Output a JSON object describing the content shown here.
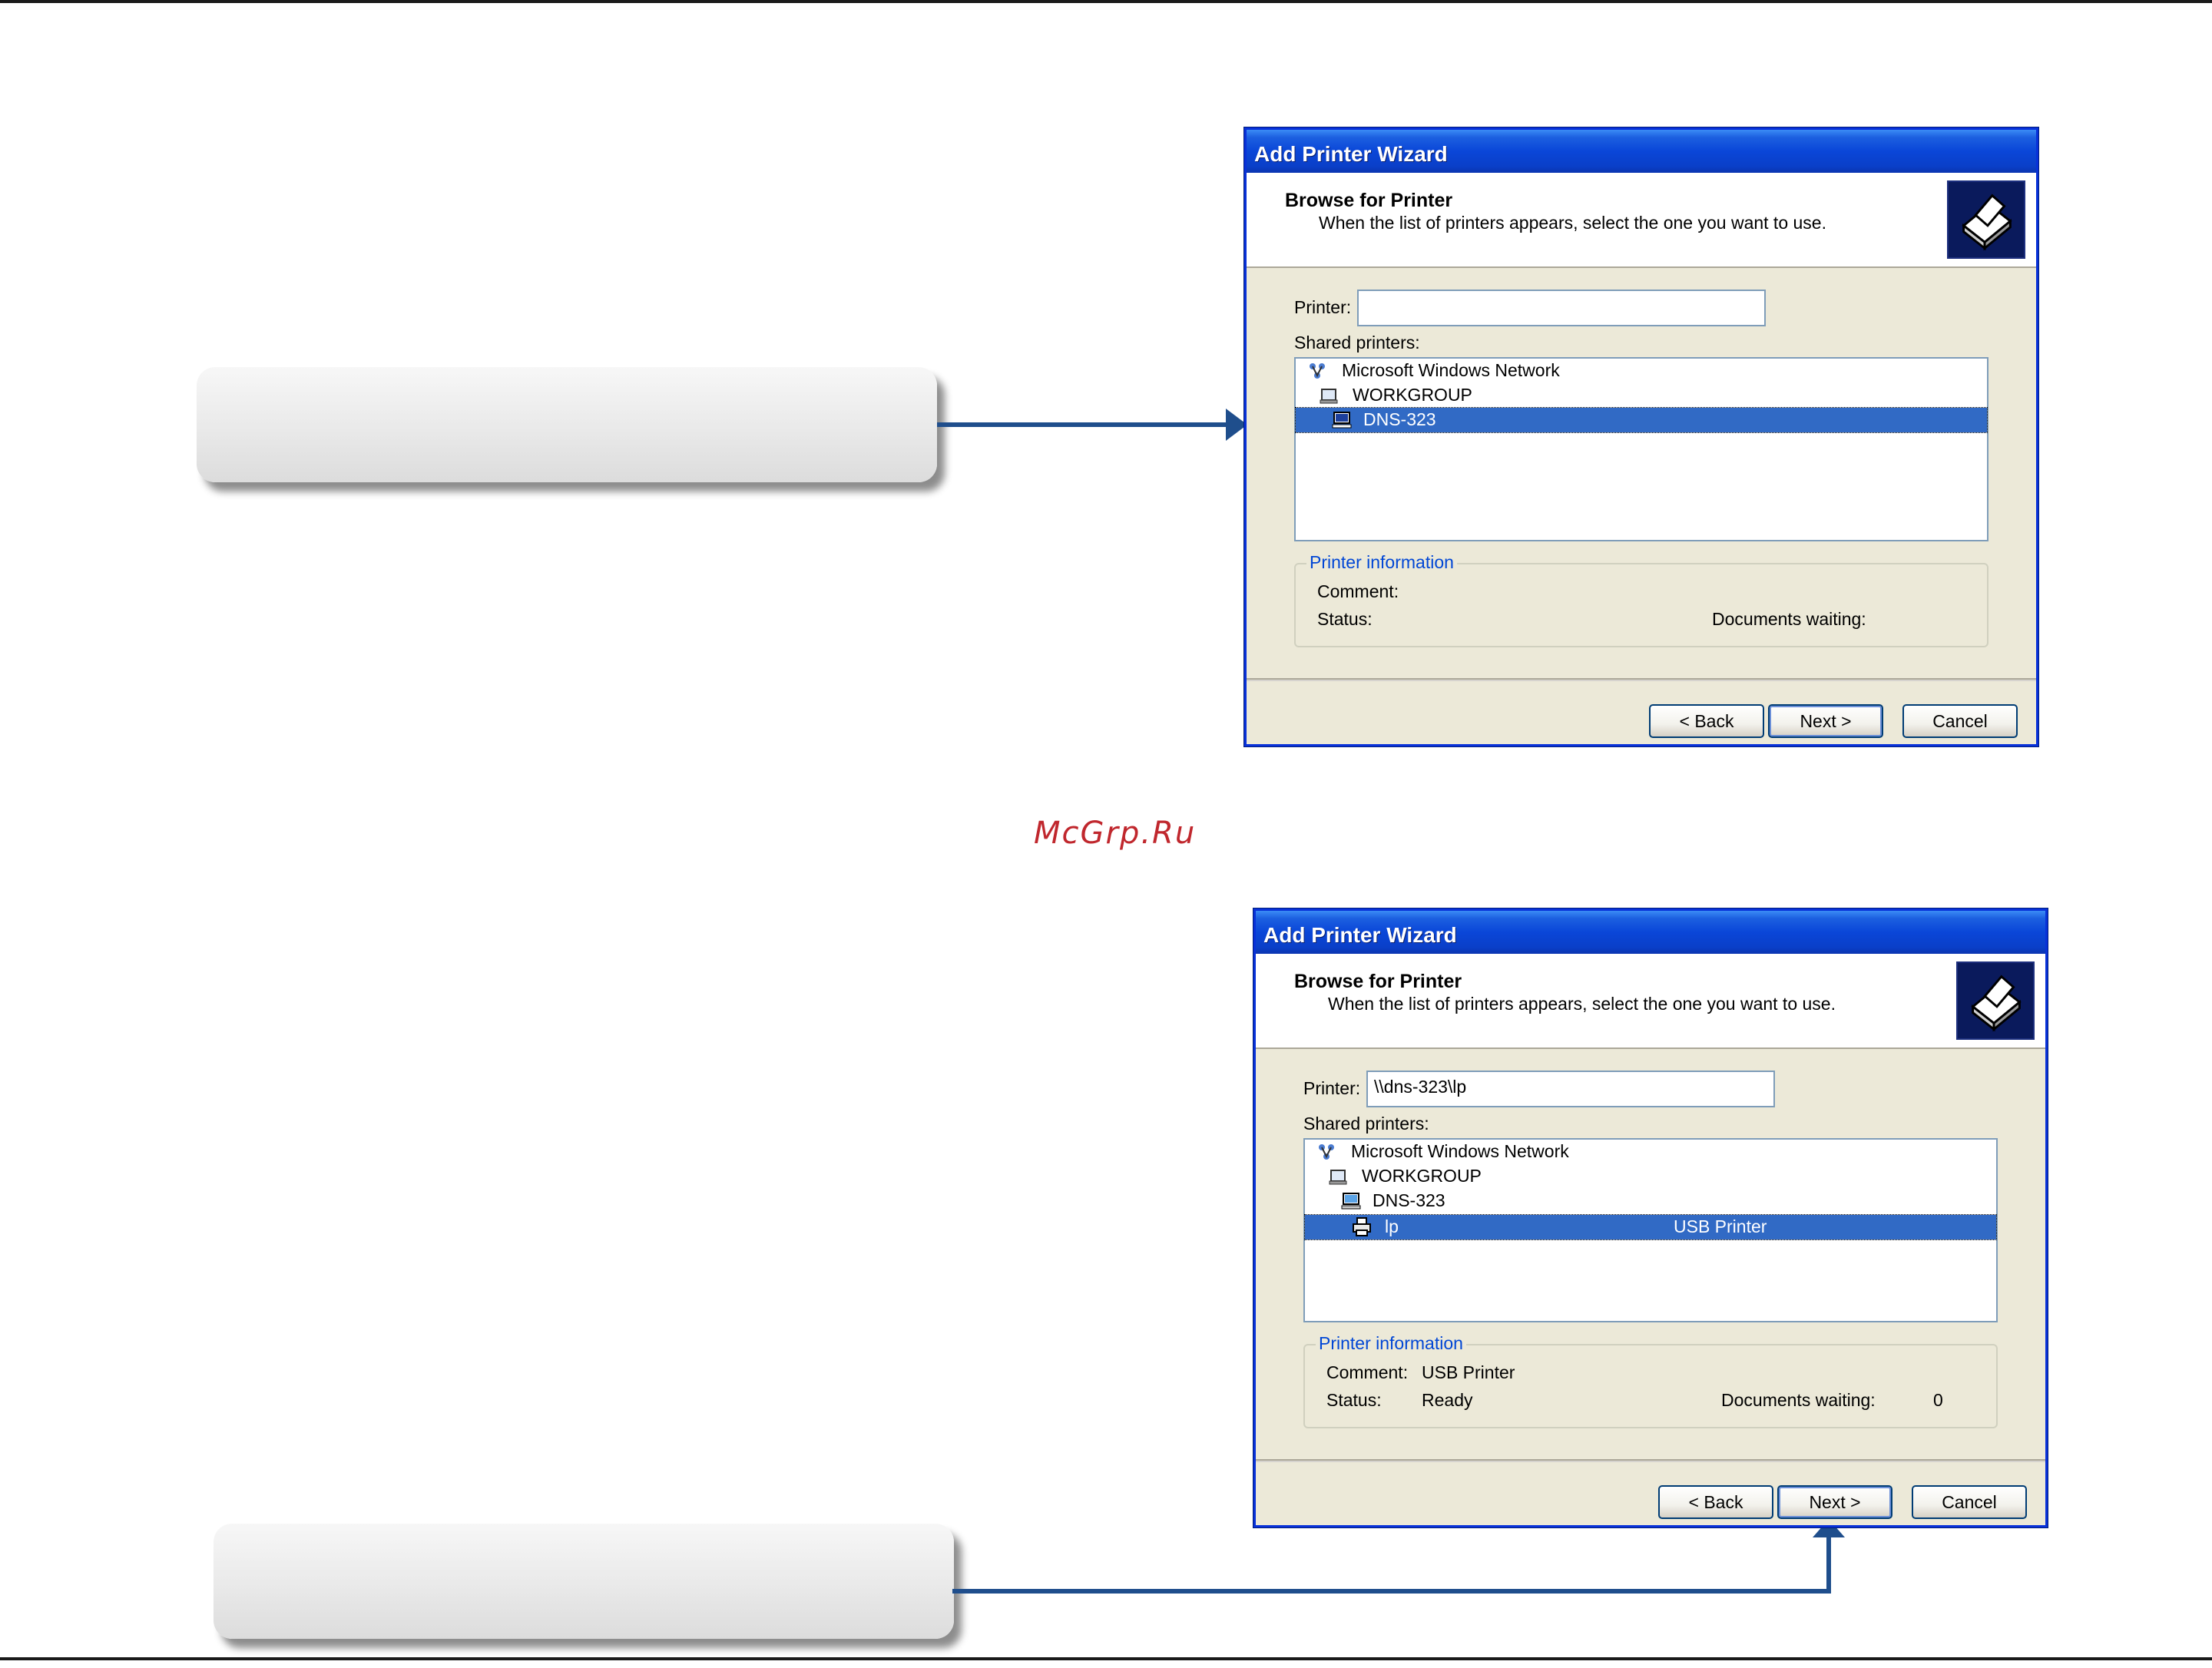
{
  "watermark": "McGrp.Ru",
  "dialog_top": {
    "title": "Add Printer Wizard",
    "header_title": "Browse for Printer",
    "header_subtitle": "When the list of printers appears, select the one you want to use.",
    "printer_label": "Printer:",
    "printer_value": "",
    "shared_label": "Shared printers:",
    "tree": [
      {
        "label": "Microsoft Windows Network",
        "icon": "network-icon"
      },
      {
        "label": "WORKGROUP",
        "icon": "workgroup-icon"
      },
      {
        "label": "DNS-323",
        "icon": "computer-icon",
        "selected": true
      }
    ],
    "info_legend": "Printer information",
    "comment_label": "Comment:",
    "comment_value": "",
    "status_label": "Status:",
    "status_value": "",
    "docs_label": "Documents waiting:",
    "docs_value": "",
    "back_label": "< Back",
    "next_label": "Next >",
    "cancel_label": "Cancel"
  },
  "dialog_bottom": {
    "title": "Add Printer Wizard",
    "header_title": "Browse for Printer",
    "header_subtitle": "When the list of printers appears, select the one you want to use.",
    "printer_label": "Printer:",
    "printer_value": "\\\\dns-323\\lp",
    "shared_label": "Shared printers:",
    "tree": [
      {
        "label": "Microsoft Windows Network",
        "icon": "network-icon"
      },
      {
        "label": "WORKGROUP",
        "icon": "workgroup-icon"
      },
      {
        "label": "DNS-323",
        "icon": "computer-icon"
      },
      {
        "label": "lp",
        "description": "USB Printer",
        "icon": "printer-icon",
        "selected": true
      }
    ],
    "info_legend": "Printer information",
    "comment_label": "Comment:",
    "comment_value": "USB Printer",
    "status_label": "Status:",
    "status_value": "Ready",
    "docs_label": "Documents waiting:",
    "docs_value": "0",
    "back_label": "< Back",
    "next_label": "Next >",
    "cancel_label": "Cancel"
  },
  "colors": {
    "connector": "#1f4e8c",
    "selection": "#316ac5",
    "titlebar": "#0a46d8",
    "watermark": "#c0272d"
  }
}
